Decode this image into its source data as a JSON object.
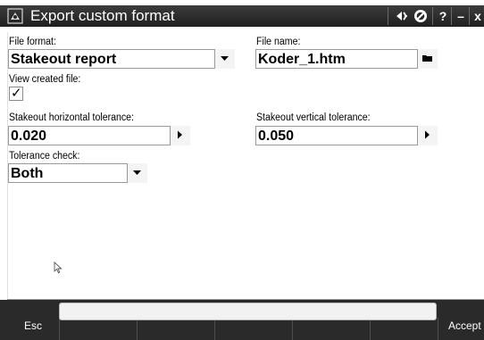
{
  "window": {
    "title": "Export custom format",
    "app_icon": "trimble-access-icon",
    "controls": {
      "gps_icon": "satellite-link-icon",
      "no_signal_icon": "no-signal-icon",
      "help": "?",
      "minimize": "–",
      "close": "x"
    }
  },
  "form": {
    "file_format": {
      "label": "File format:",
      "value": "Stakeout report"
    },
    "file_name": {
      "label": "File name:",
      "value": "Koder_1.htm"
    },
    "view_created_file": {
      "label": "View created file:",
      "checked": true,
      "check_glyph": "✓"
    },
    "horizontal_tolerance": {
      "label": "Stakeout horizontal tolerance:",
      "value": "0.020"
    },
    "vertical_tolerance": {
      "label": "Stakeout vertical tolerance:",
      "value": "0.050"
    },
    "tolerance_check": {
      "label": "Tolerance check:",
      "value": "Both"
    }
  },
  "softkeys": {
    "esc": "Esc",
    "accept": "Accept"
  },
  "colors": {
    "titlebar": "#2b2b2b",
    "softkey_bar": "#2a2a2a",
    "field_border": "#9a9a9a"
  }
}
